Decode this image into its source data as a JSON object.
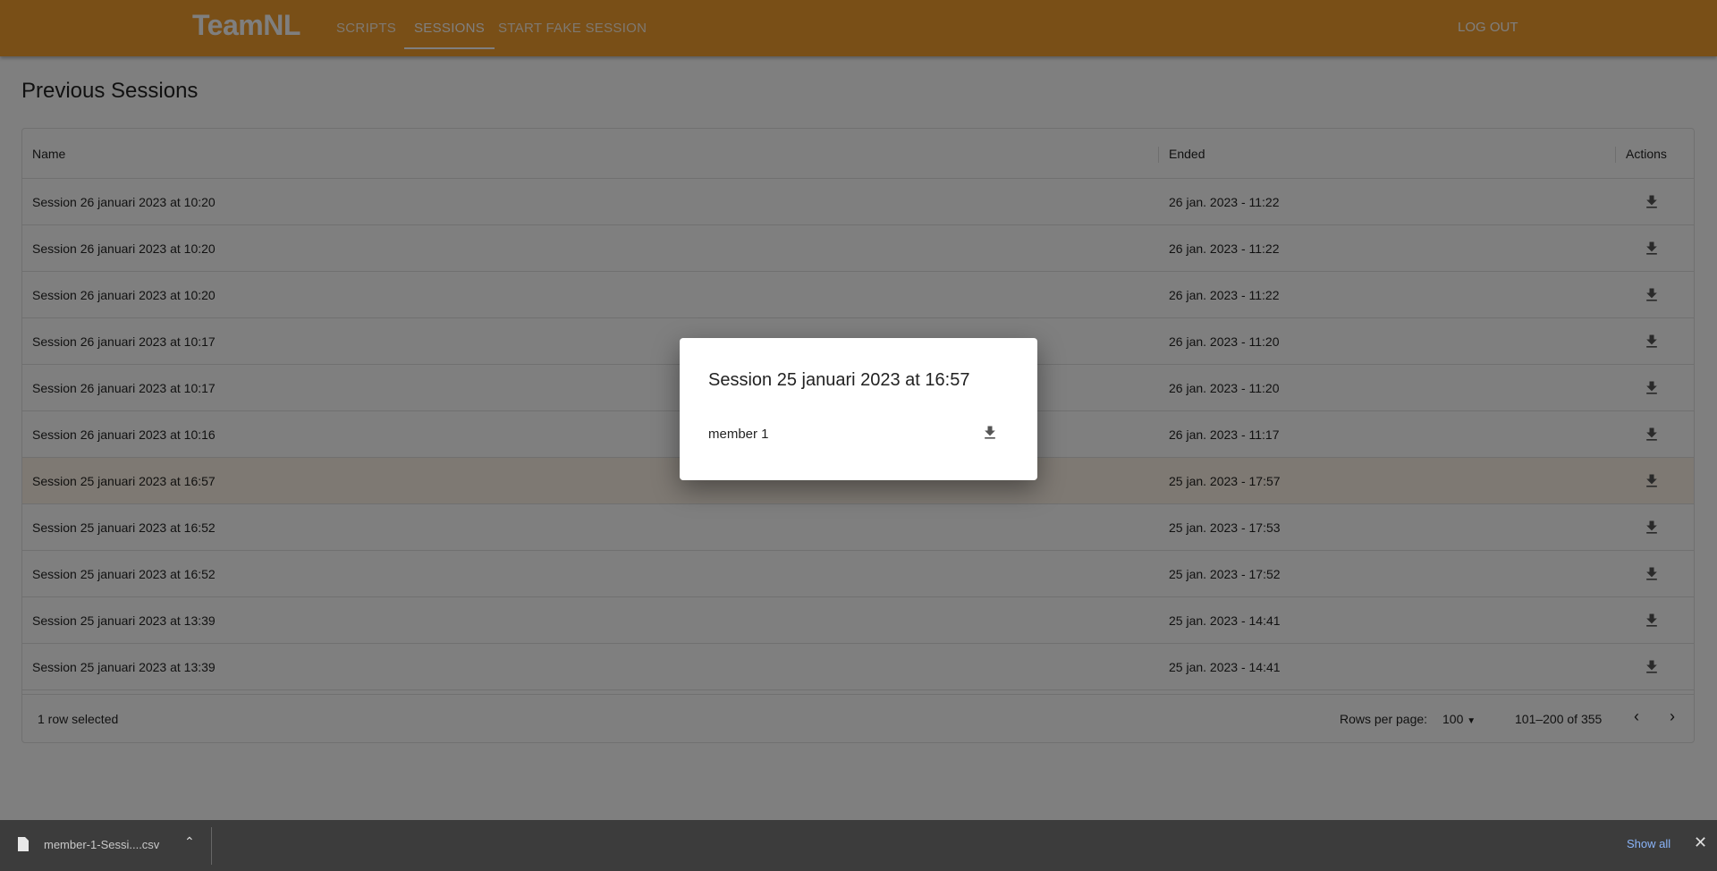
{
  "appbar": {
    "logo": "TeamNL",
    "nav": [
      "SCRIPTS",
      "SESSIONS",
      "START FAKE SESSION"
    ],
    "logout": "LOG OUT"
  },
  "page": {
    "title": "Previous Sessions"
  },
  "table": {
    "columns": [
      "Name",
      "Ended",
      "Actions"
    ],
    "rows": [
      {
        "name": "Session 26 januari 2023 at 10:20",
        "ended": "26 jan. 2023 - 11:22"
      },
      {
        "name": "Session 26 januari 2023 at 10:20",
        "ended": "26 jan. 2023 - 11:22"
      },
      {
        "name": "Session 26 januari 2023 at 10:20",
        "ended": "26 jan. 2023 - 11:22"
      },
      {
        "name": "Session 26 januari 2023 at 10:17",
        "ended": "26 jan. 2023 - 11:20"
      },
      {
        "name": "Session 26 januari 2023 at 10:17",
        "ended": "26 jan. 2023 - 11:20"
      },
      {
        "name": "Session 26 januari 2023 at 10:16",
        "ended": "26 jan. 2023 - 11:17"
      },
      {
        "name": "Session 25 januari 2023 at 16:57",
        "ended": "25 jan. 2023 - 17:57",
        "selected": true
      },
      {
        "name": "Session 25 januari 2023 at 16:52",
        "ended": "25 jan. 2023 - 17:53"
      },
      {
        "name": "Session 25 januari 2023 at 16:52",
        "ended": "25 jan. 2023 - 17:52"
      },
      {
        "name": "Session 25 januari 2023 at 13:39",
        "ended": "25 jan. 2023 - 14:41"
      },
      {
        "name": "Session 25 januari 2023 at 13:39",
        "ended": "25 jan. 2023 - 14:41"
      }
    ],
    "footer": {
      "selected": "1 row selected",
      "rows_per_page_label": "Rows per page:",
      "rows_per_page": "100",
      "range": "101–200 of 355"
    }
  },
  "dialog": {
    "title": "Session 25 januari 2023 at 16:57",
    "members": [
      "member 1"
    ]
  },
  "downloads": {
    "file": "member-1-Sessi....csv",
    "show_all": "Show all"
  }
}
